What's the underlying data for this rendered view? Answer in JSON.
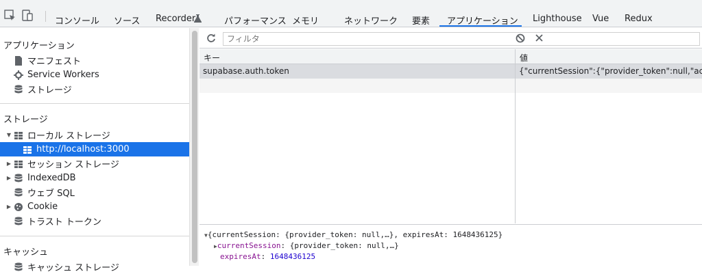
{
  "tabs": [
    {
      "label": "コンソール",
      "active": false
    },
    {
      "label": "ソース",
      "active": false
    },
    {
      "label": "Recorder",
      "active": false
    },
    {
      "label": "パフォーマンス",
      "active": false
    },
    {
      "label": "メモリ",
      "active": false
    },
    {
      "label": "ネットワーク",
      "active": false
    },
    {
      "label": "要素",
      "active": false
    },
    {
      "label": "アプリケーション",
      "active": true
    },
    {
      "label": "Lighthouse",
      "active": false
    },
    {
      "label": "Vue",
      "active": false
    },
    {
      "label": "Redux",
      "active": false
    }
  ],
  "sidebar": {
    "application_title": "アプリケーション",
    "app_items": [
      "マニフェスト",
      "Service Workers",
      "ストレージ"
    ],
    "storage_title": "ストレージ",
    "storage_items": [
      {
        "label": "ローカル ストレージ",
        "expanded": true
      },
      {
        "label": "http://localhost:3000",
        "selected": true
      },
      {
        "label": "セッション ストレージ",
        "expanded": false
      },
      {
        "label": "IndexedDB",
        "expanded": false
      },
      {
        "label": "ウェブ SQL"
      },
      {
        "label": "Cookie",
        "expanded": false
      },
      {
        "label": "トラスト トークン"
      }
    ],
    "cache_title": "キャッシュ",
    "cache_partial": "キャッシュ ストレージ"
  },
  "toolbar": {
    "filter_placeholder": "フィルタ"
  },
  "table": {
    "headers": {
      "key": "キー",
      "value": "値"
    },
    "rows": [
      {
        "key": "supabase.auth.token",
        "value": "{\"currentSession\":{\"provider_token\":null,\"access"
      }
    ]
  },
  "preview": {
    "line1": "{currentSession: {provider_token: null,…}, expiresAt: 1648436125}",
    "line2_key": "currentSession",
    "line2_val": ": {provider_token: null,…}",
    "line3_key": "expiresAt",
    "line3_val": "1648436125"
  },
  "colors": {
    "accent": "#1a73e8",
    "selection": "#dadce0"
  }
}
